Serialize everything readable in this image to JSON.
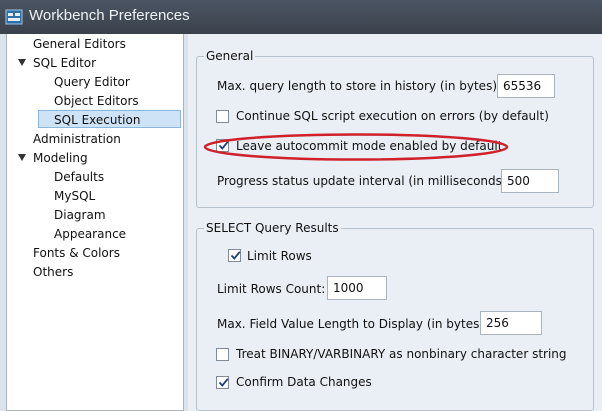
{
  "window": {
    "title": "Workbench Preferences"
  },
  "sidebar": {
    "items": [
      {
        "label": "General Editors",
        "expandable": false,
        "selected": false
      },
      {
        "label": "SQL Editor",
        "expandable": true,
        "selected": false
      },
      {
        "label": "Query Editor",
        "expandable": false,
        "selected": false
      },
      {
        "label": "Object Editors",
        "expandable": false,
        "selected": false
      },
      {
        "label": "SQL Execution",
        "expandable": false,
        "selected": true
      },
      {
        "label": "Administration",
        "expandable": false,
        "selected": false
      },
      {
        "label": "Modeling",
        "expandable": true,
        "selected": false
      },
      {
        "label": "Defaults",
        "expandable": false,
        "selected": false
      },
      {
        "label": "MySQL",
        "expandable": false,
        "selected": false
      },
      {
        "label": "Diagram",
        "expandable": false,
        "selected": false
      },
      {
        "label": "Appearance",
        "expandable": false,
        "selected": false
      },
      {
        "label": "Fonts & Colors",
        "expandable": false,
        "selected": false
      },
      {
        "label": "Others",
        "expandable": false,
        "selected": false
      }
    ]
  },
  "general": {
    "title": "General",
    "max_query_label": "Max. query length to store in history (in bytes):",
    "max_query_value": "65536",
    "continue_on_errors_label": "Continue SQL script execution on errors (by default)",
    "continue_on_errors_checked": false,
    "autocommit_label": "Leave autocommit mode enabled by default",
    "autocommit_checked": true,
    "progress_label": "Progress status update interval (in milliseconds):",
    "progress_value": "500"
  },
  "select_results": {
    "title": "SELECT Query Results",
    "limit_rows_label": "Limit Rows",
    "limit_rows_checked": true,
    "limit_count_label": "Limit Rows Count:",
    "limit_count_value": "1000",
    "max_field_label": "Max. Field Value Length to Display (in bytes):",
    "max_field_value": "256",
    "treat_binary_label": "Treat BINARY/VARBINARY as nonbinary character string",
    "treat_binary_checked": false,
    "confirm_changes_label": "Confirm Data Changes",
    "confirm_changes_checked": true
  },
  "colors": {
    "highlight_ellipse": "#d0202a",
    "selection": "#cfe3f7"
  }
}
